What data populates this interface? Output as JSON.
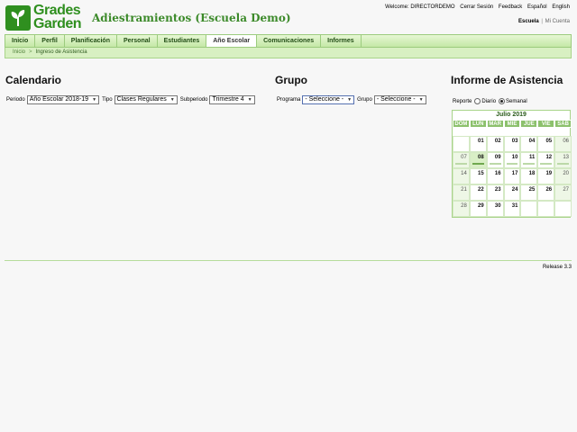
{
  "brand": {
    "line1": "Grades",
    "line2": "Garden"
  },
  "org_title": "Adiestramientos (Escuela Demo)",
  "top_links": {
    "welcome": "Welcome: DIRECTORDEMO",
    "logout": "Cerrar Sesión",
    "feedback": "Feedback",
    "espanol": "Español",
    "english": "English"
  },
  "school_links": {
    "school": "Escuela",
    "separator": "|",
    "account": "Mi Cuenta"
  },
  "nav": [
    {
      "label": "Inicio"
    },
    {
      "label": "Perfil"
    },
    {
      "label": "Planificación"
    },
    {
      "label": "Personal"
    },
    {
      "label": "Estudiantes"
    },
    {
      "label": "Año Escolar",
      "active": true
    },
    {
      "label": "Comunicaciones"
    },
    {
      "label": "Informes"
    }
  ],
  "breadcrumb": {
    "home": "Inicio",
    "separator": ">",
    "current": "Ingreso de Asistencia"
  },
  "calendario": {
    "title": "Calendario",
    "periodo_label": "Periodo",
    "periodo_value": "Año Escolar 2018-19",
    "tipo_label": "Tipo",
    "tipo_value": "Clases Regulares",
    "subperiodo_label": "Subperiodo",
    "subperiodo_value": "Trimestre 4"
  },
  "grupo": {
    "title": "Grupo",
    "programa_label": "Programa",
    "programa_value": "- Seleccione -",
    "grupo_label": "Grupo",
    "grupo_value": "- Seleccione -"
  },
  "informe": {
    "title": "Informe de Asistencia",
    "reporte_label": "Reporte",
    "diario_label": "Diario",
    "semanal_label": "Semanal",
    "selected_mode": "Semanal"
  },
  "calendar_widget": {
    "month": "Julio 2019",
    "days_of_week": [
      "DOM",
      "LUN",
      "MAR",
      "MIE",
      "JUE",
      "VIE",
      "SÁB"
    ],
    "weeks": [
      [
        "",
        "01",
        "02",
        "03",
        "04",
        "05",
        "06"
      ],
      [
        "07",
        "08",
        "09",
        "10",
        "11",
        "12",
        "13"
      ],
      [
        "14",
        "15",
        "16",
        "17",
        "18",
        "19",
        "20"
      ],
      [
        "21",
        "22",
        "23",
        "24",
        "25",
        "26",
        "27"
      ],
      [
        "28",
        "29",
        "30",
        "31",
        "",
        "",
        ""
      ]
    ],
    "selected_day": "08",
    "week_with_bars": 1
  },
  "release": "Release 3.3",
  "colors": {
    "brand_green": "#2f8f1f",
    "nav_bg": "#c4e8a6",
    "calendar_header": "#8cc16c"
  }
}
